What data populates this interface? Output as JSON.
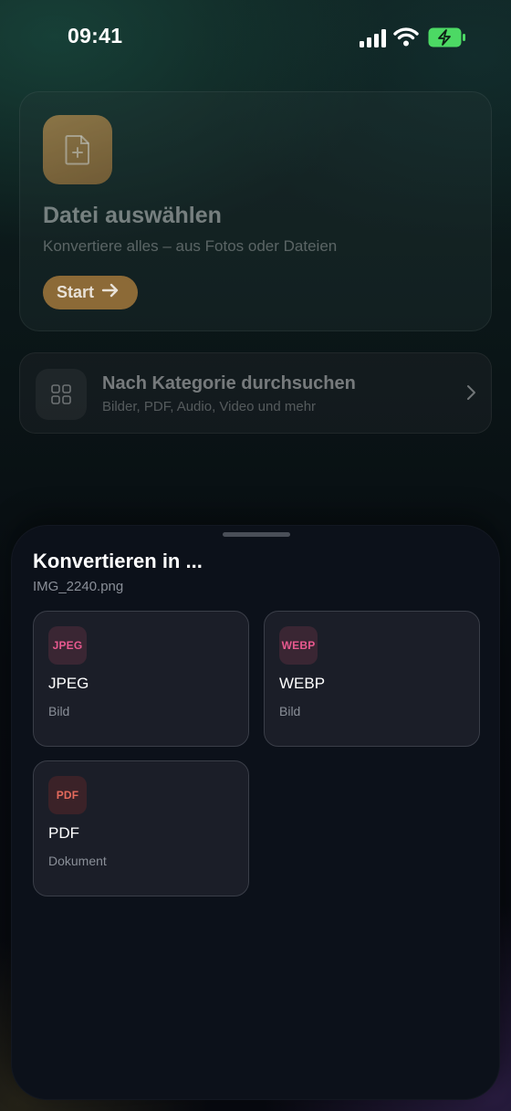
{
  "status_bar": {
    "time": "09:41",
    "signal_icon": "cellular-signal-icon",
    "wifi_icon": "wifi-icon",
    "battery_icon": "battery-charging-icon"
  },
  "main_card": {
    "icon": "file-plus-icon",
    "title": "Datei auswählen",
    "subtitle": "Konvertiere alles – aus Fotos oder Dateien",
    "start_label": "Start",
    "start_icon": "arrow-right-icon"
  },
  "browse_card": {
    "icon": "grid-icon",
    "title": "Nach Kategorie durchsuchen",
    "subtitle": "Bilder, PDF, Audio, Video und mehr",
    "chevron_icon": "chevron-right-icon"
  },
  "sheet": {
    "title": "Konvertieren in ...",
    "filename": "IMG_2240.png",
    "formats": [
      {
        "badge": "JPEG",
        "name": "JPEG",
        "type": "Bild",
        "color": "#e8598f"
      },
      {
        "badge": "WEBP",
        "name": "WEBP",
        "type": "Bild",
        "color": "#e8598f"
      },
      {
        "badge": "PDF",
        "name": "PDF",
        "type": "Dokument",
        "color": "#e56a5c"
      }
    ]
  },
  "colors": {
    "accent_gold": "#b08a4e",
    "battery_green": "#4cd964",
    "sheet_bg": "#0c111a",
    "card_bg": "#1b1e28"
  }
}
